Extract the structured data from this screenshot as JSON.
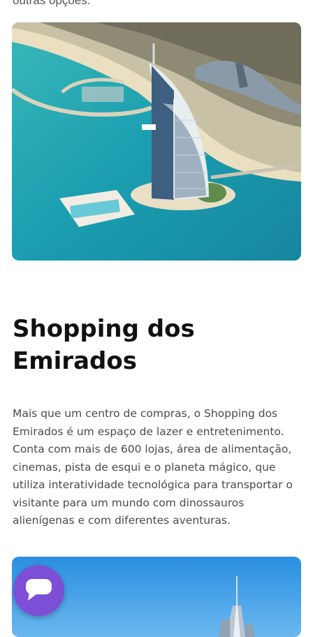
{
  "previous_text_fragment": "outras opções.",
  "top_photo": {
    "name": "burj-al-arab-aerial-photo"
  },
  "section": {
    "title": "Shopping dos Emirados",
    "description": "Mais que um centro de compras, o Shopping dos Emirados é um espaço de lazer e entretenimento. Conta com mais de 600 lojas, área de alimentação, cinemas, pista de esqui e o planeta mágico, que utiliza interatividade tecnológica para transportar o visitante para um mundo com dinossauros alienígenas e com diferentes aventuras."
  },
  "bottom_photo": {
    "name": "burj-khalifa-sky-photo"
  },
  "chat_button": {
    "icon": "chat-bubble-icon",
    "color": "#7c4fd6"
  }
}
